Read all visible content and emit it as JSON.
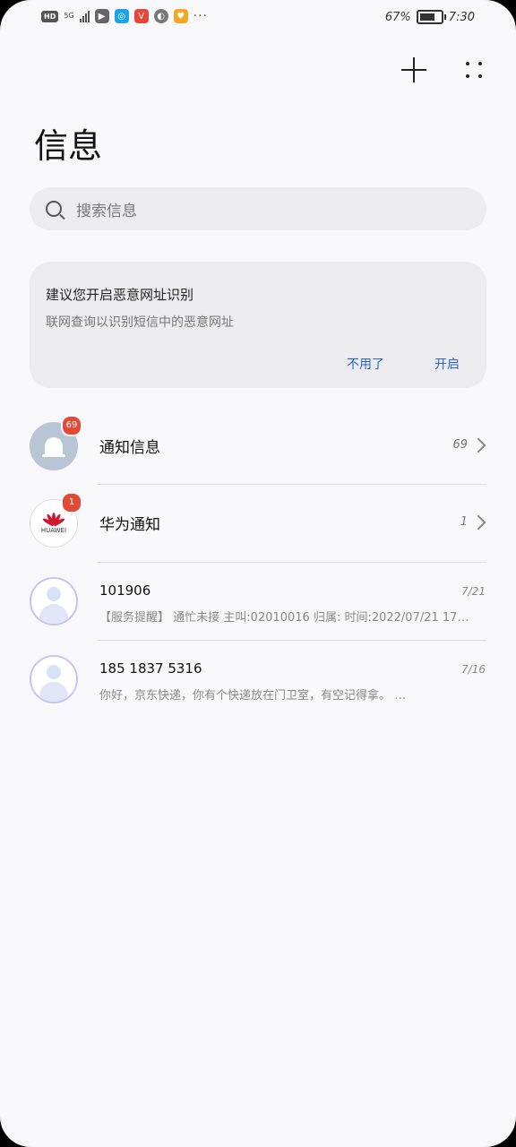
{
  "status_bar": {
    "hd": "HD",
    "network": "5G",
    "more": "···",
    "battery_percent": "67%",
    "battery_level": 0.67,
    "time": "7:30"
  },
  "toolbar": {
    "add_icon": "plus-icon",
    "more_icon": "more-grid-icon"
  },
  "page_title": "信息",
  "search": {
    "placeholder": "搜索信息",
    "icon": "search-icon"
  },
  "security_card": {
    "title": "建议您开启恶意网址识别",
    "subtitle": "联网查询以识别短信中的恶意网址",
    "dismiss_label": "不用了",
    "enable_label": "开启",
    "accent_color": "#2a64c9"
  },
  "conversations": [
    {
      "title": "通知信息",
      "badge": "69",
      "count": "69",
      "icon": "bell-icon"
    },
    {
      "title": "华为通知",
      "badge": "1",
      "count": "1",
      "icon": "huawei-logo",
      "avatar_text": "HUAWEI"
    },
    {
      "title": "1019​06",
      "date": "7/21",
      "snippet": "【服务提醒】 通忙未接 主叫:02010016 归属: 时间:2022/07/21 17…"
    },
    {
      "title": "185 1837 5316",
      "date": "7/16",
      "snippet": "你好，京东快递，你有个快递放在门卫室，有空记得拿。 …"
    }
  ]
}
